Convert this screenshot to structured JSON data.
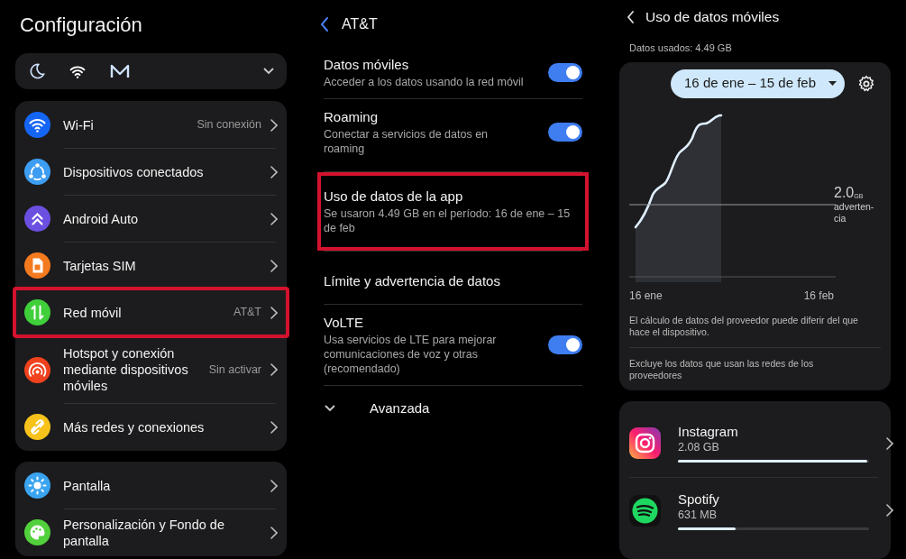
{
  "settings": {
    "title": "Configuración",
    "quick_bar": {
      "expanded": false
    },
    "groups": [
      [
        {
          "label": "Wi-Fi",
          "value": "Sin conexión",
          "color": "#1565f5",
          "highlighted": false
        },
        {
          "label": "Dispositivos conectados",
          "color": "#3d9df2",
          "highlighted": false
        },
        {
          "label": "Android Auto",
          "color": "#6b4fe0",
          "highlighted": false
        },
        {
          "label": "Tarjetas SIM",
          "color": "#f47a1f",
          "highlighted": false
        },
        {
          "label": "Red móvil",
          "value": "AT&T",
          "color": "#3fcf3a",
          "highlighted": true
        },
        {
          "label": "Hotspot y conexión mediante dispositivos móviles",
          "value": "Sin activar",
          "color": "#f0421c",
          "highlighted": false
        },
        {
          "label": "Más redes y conexiones",
          "color": "#f7c21a",
          "highlighted": false
        }
      ],
      [
        {
          "label": "Pantalla",
          "color": "#3aa4f0",
          "highlighted": false
        },
        {
          "label": "Personalización y Fondo de pantalla",
          "color": "#52d13c",
          "highlighted": false
        }
      ]
    ]
  },
  "carrier": {
    "title": "AT&T",
    "items": [
      {
        "kind": "toggle",
        "label": "Datos móviles",
        "summary": "Acceder a los datos usando la red móvil",
        "on": true,
        "highlighted": false
      },
      {
        "kind": "toggle",
        "label": "Roaming",
        "summary": "Conectar a servicios de datos en roaming",
        "on": true,
        "highlighted": false
      },
      {
        "kind": "plain",
        "label": "Uso de datos de la app",
        "summary": "Se usaron 4.49 GB en el período: 16 de ene – 15 de feb",
        "highlighted": true
      },
      {
        "kind": "plain",
        "label": "Límite y advertencia de datos",
        "highlighted": false
      },
      {
        "kind": "toggle",
        "label": "VoLTE",
        "summary": "Usa servicios de LTE para mejorar comunicaciones de voz y otras (recomendado)",
        "on": true,
        "highlighted": false
      }
    ],
    "advanced": {
      "label": "Avanzada",
      "expanded": false
    }
  },
  "usage": {
    "title": "Uso de datos móviles",
    "used": "Datos usados: 4.49 GB",
    "period": "16 de ene – 15 de feb",
    "warning": {
      "value": "2.0",
      "unit": "GB",
      "label_lines": [
        "adverten-",
        "cia"
      ]
    },
    "axis_start": "16 ene",
    "axis_end": "16 feb",
    "notes": [
      "El cálculo de datos del proveedor puede diferir del que hace el dispositivo.",
      "Excluye los datos que usan las redes de los proveedores"
    ],
    "apps": [
      {
        "name": "Instagram",
        "amount": "2.08 GB",
        "level": 0.99
      },
      {
        "name": "Spotify",
        "amount": "631 MB",
        "level": 0.3
      }
    ]
  }
}
